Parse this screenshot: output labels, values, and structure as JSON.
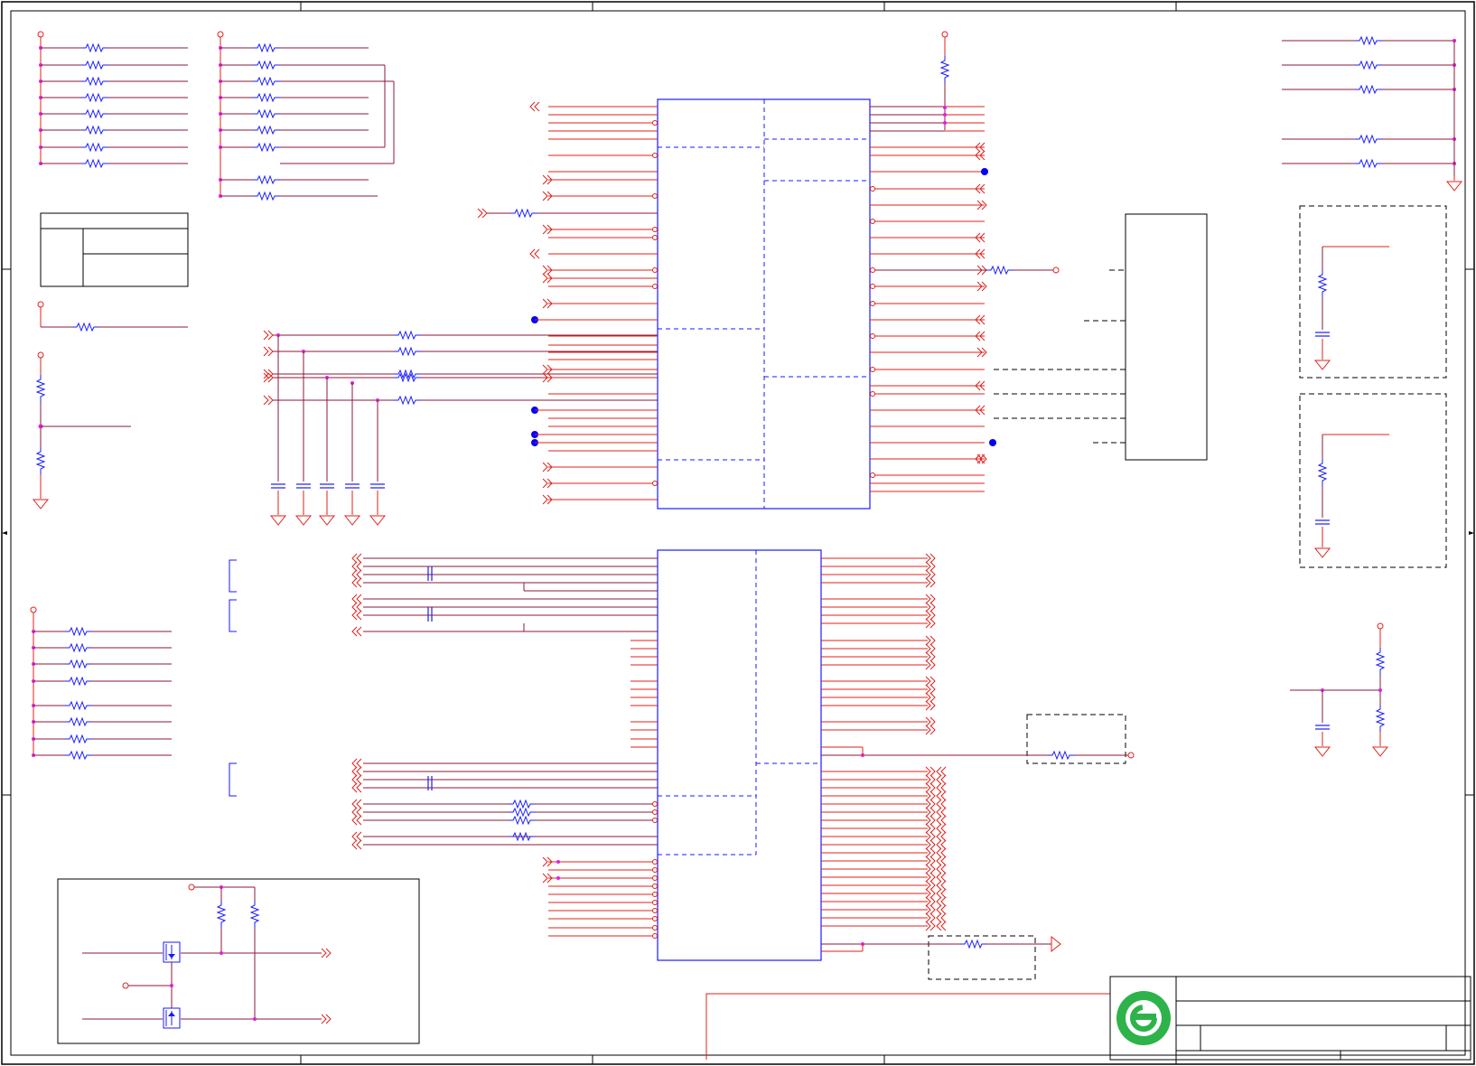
{
  "sheet": {
    "type": "electronic schematic sheet",
    "colors": {
      "background": "#ffffff",
      "border": "#000000",
      "wire": "#8b1a3a",
      "net_stub": "#e0201a",
      "chip_outline": "#1a1aff",
      "junction": "#e020e0",
      "net_flag": "#0000ff",
      "logo_green": "#2db34a"
    },
    "title_block": {
      "logo": "green-circle-e-logo"
    }
  },
  "icons": {
    "resistor": "zigzag-resistor-icon",
    "capacitor": "parallel-plate-capacitor-icon",
    "ground": "triangle-ground-icon",
    "offpage": "double-chevron-offpage-connector-icon",
    "power_port": "open-circle-power-port-icon",
    "mosfet": "mosfet-transistor-icon"
  }
}
